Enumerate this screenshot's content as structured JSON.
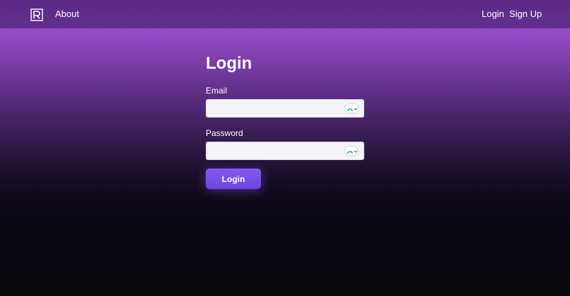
{
  "nav": {
    "logo_icon": "r-logo-icon",
    "about": "About",
    "login": "Login",
    "signup": "Sign Up"
  },
  "form": {
    "title": "Login",
    "email_label": "Email",
    "email_value": "",
    "password_label": "Password",
    "password_value": "",
    "autofill_icon": "password-manager-icon",
    "submit_label": "Login"
  },
  "colors": {
    "nav_bg": "#5a2a84",
    "accent": "#7a4fe8",
    "gradient_top": "#9a4ccc",
    "gradient_bottom": "#07050e"
  }
}
